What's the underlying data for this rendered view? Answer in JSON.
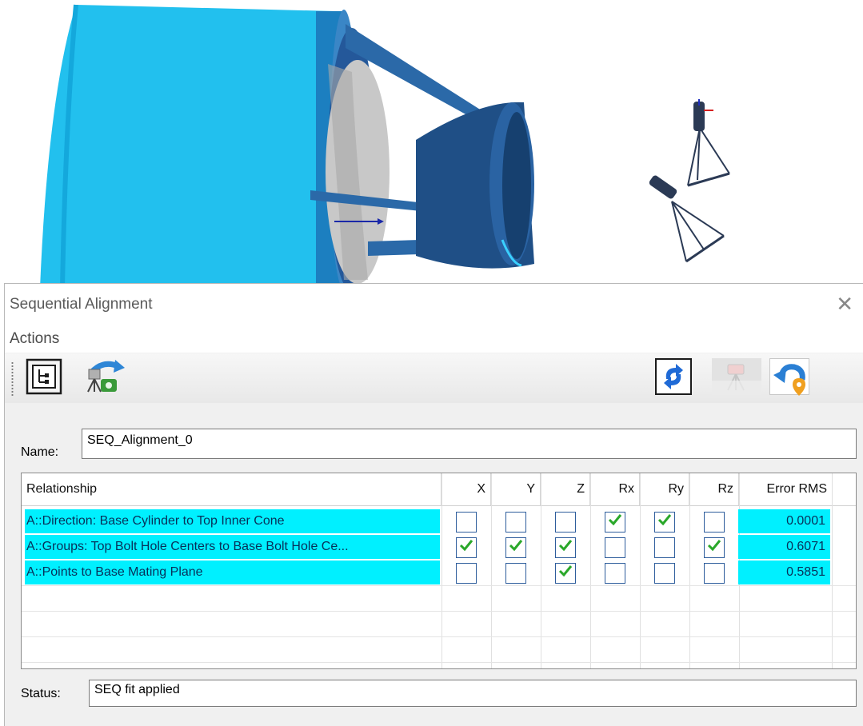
{
  "dialog": {
    "title": "Sequential Alignment",
    "close_glyph": "✕",
    "menu": {
      "actions_label": "Actions"
    },
    "toolbar": {
      "left_buttons": [
        "tree-view-icon",
        "instrument-transform-icon"
      ],
      "right_buttons": [
        "refresh-icon",
        "instrument-disabled-icon",
        "undo-location-icon"
      ]
    },
    "name_label": "Name:",
    "name_value": "SEQ_Alignment_0",
    "status_label": "Status:",
    "status_value": "SEQ fit applied",
    "table": {
      "columns": [
        "Relationship",
        "X",
        "Y",
        "Z",
        "Rx",
        "Ry",
        "Rz",
        "Error RMS"
      ],
      "rows": [
        {
          "relationship": "A::Direction: Base Cylinder to Top Inner Cone",
          "checks": [
            false,
            false,
            false,
            true,
            true,
            false
          ],
          "error_rms": "0.0001"
        },
        {
          "relationship": "A::Groups: Top Bolt Hole Centers to Base Bolt Hole Ce...",
          "checks": [
            true,
            true,
            true,
            false,
            false,
            true
          ],
          "error_rms": "0.6071"
        },
        {
          "relationship": "A::Points to Base Mating Plane",
          "checks": [
            false,
            false,
            true,
            false,
            false,
            false
          ],
          "error_rms": "0.5851"
        }
      ]
    }
  },
  "colors": {
    "cylinder": "#26c4f0",
    "cone": "#1f4f86",
    "row_highlight": "#00f0ff",
    "check": "#2aa82a"
  }
}
